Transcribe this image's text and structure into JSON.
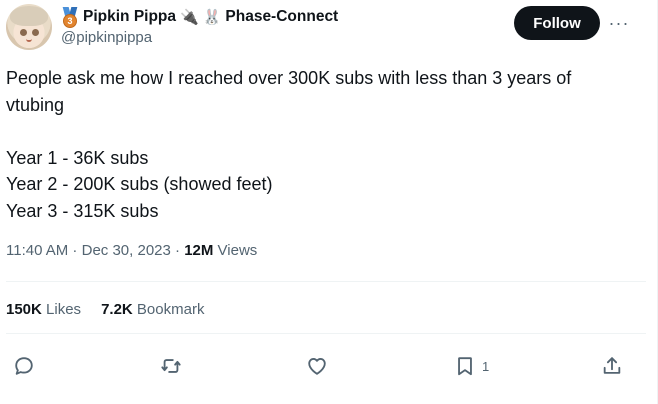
{
  "author": {
    "display_name": "Pipkin Pippa",
    "emoji_plug": "🔌",
    "emoji_rabbit": "🐰",
    "affiliation": "Phase-Connect",
    "handle": "@pipkinpippa"
  },
  "header": {
    "follow_label": "Follow",
    "more_label": "···"
  },
  "tweet": {
    "lines": [
      "People ask me how I reached over 300K subs with less than 3 years of",
      "vtubing",
      "",
      "Year 1 - 36K subs",
      "Year 2 - 200K subs (showed feet)",
      "Year 3 - 315K subs"
    ]
  },
  "meta": {
    "time": "11:40 AM",
    "separator": " · ",
    "date": "Dec 30, 2023",
    "views_count": "12M",
    "views_label": "Views"
  },
  "stats": {
    "likes_count": "150K",
    "likes_label": "Likes",
    "bookmarks_count": "7.2K",
    "bookmarks_label": "Bookmark"
  },
  "actions": {
    "bookmark_count": "1"
  },
  "icons": {
    "medal": "medal-icon",
    "reply": "reply-icon",
    "retweet": "retweet-icon",
    "like": "heart-icon",
    "bookmark": "bookmark-icon",
    "share": "share-icon"
  }
}
